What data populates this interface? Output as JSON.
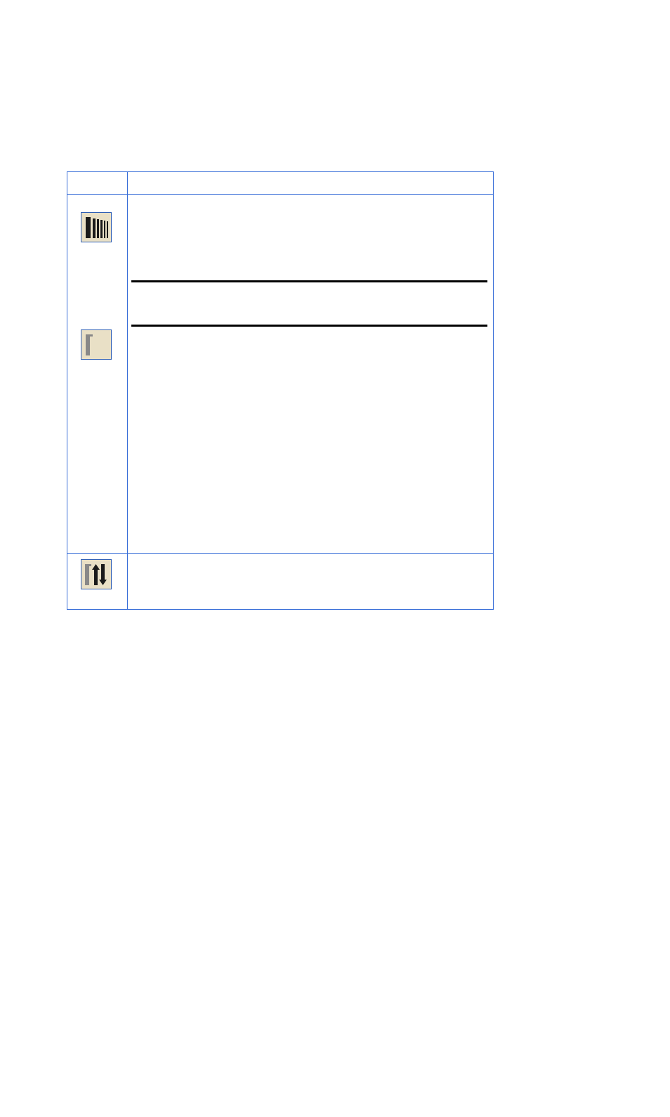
{
  "table": {
    "header": {
      "icon_col": "",
      "desc_col": ""
    },
    "rows": [
      {
        "icons": [
          {
            "name": "perspective-lines-icon"
          },
          {
            "name": "single-bar-icon"
          }
        ],
        "desc": ""
      },
      {
        "icons": [
          {
            "name": "bar-arrows-icon"
          }
        ],
        "desc": ""
      }
    ]
  }
}
